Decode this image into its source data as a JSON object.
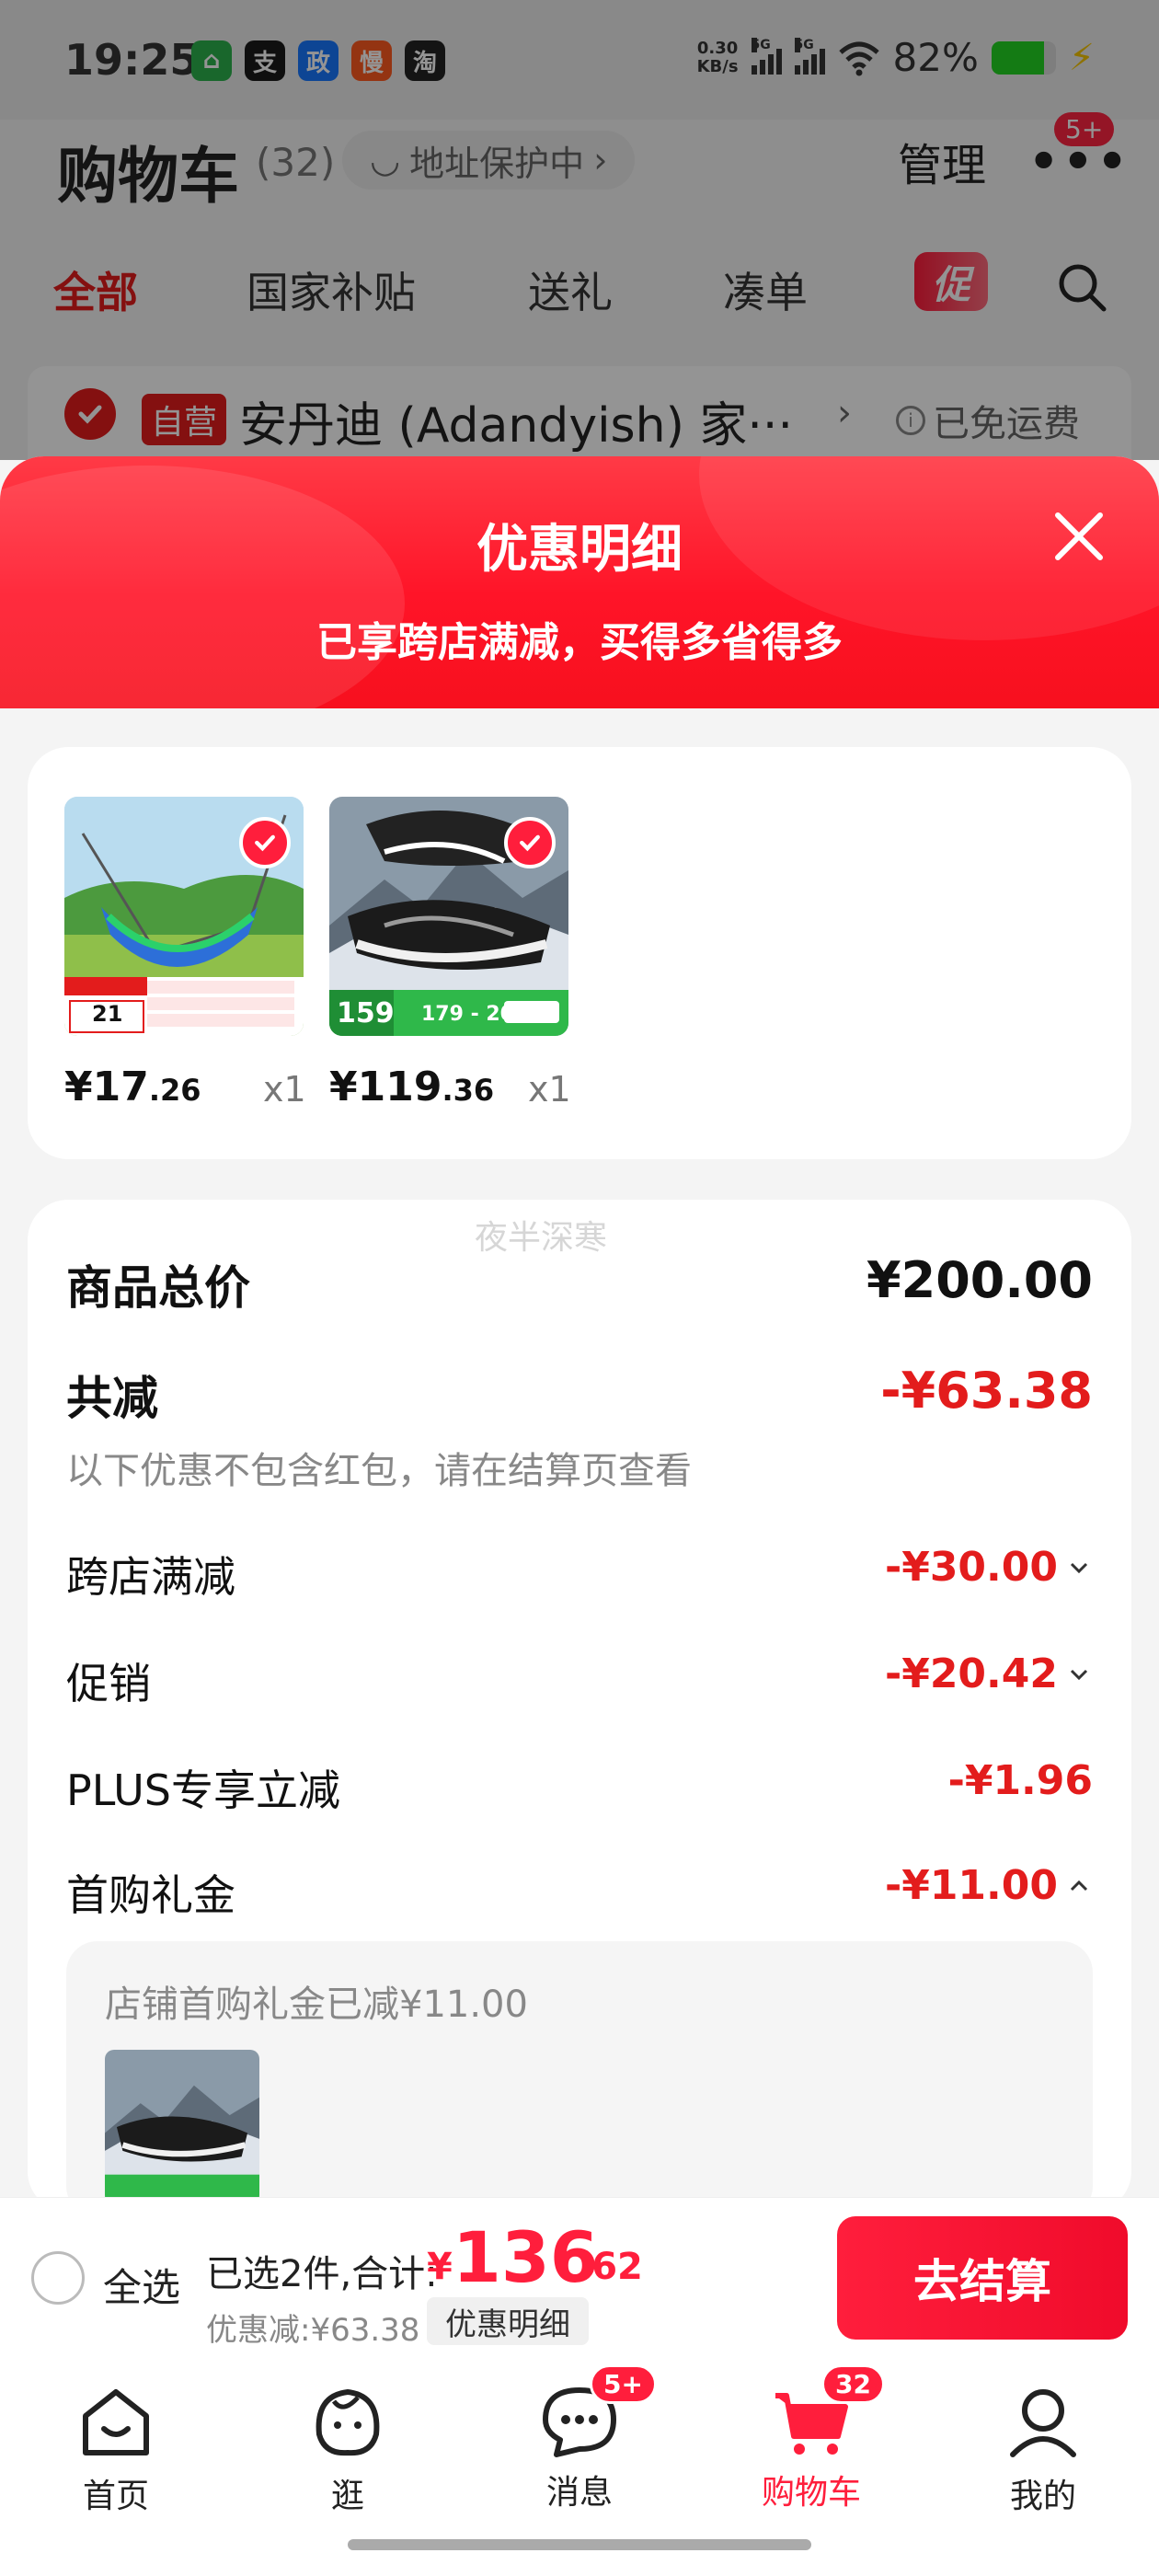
{
  "status_bar": {
    "time": "19:25",
    "apps": [
      {
        "name": "qianniu-app-icon",
        "glyph": "⌂",
        "color": "#2bb24c"
      },
      {
        "name": "alipay-app-icon",
        "glyph": "支",
        "color": "#1a1a1a"
      },
      {
        "name": "dingtalk-app-icon",
        "glyph": "政",
        "color": "#1677ff"
      },
      {
        "name": "slow-app-icon",
        "glyph": "慢",
        "color": "#ff5a1f"
      },
      {
        "name": "taobao-app-icon",
        "glyph": "淘",
        "color": "#222222"
      }
    ],
    "net_speed_value": "0.30",
    "net_speed_unit": "KB/s",
    "signal1_label": "5G",
    "signal2_label": "5G",
    "battery_percent_text": "82%",
    "battery_level": 0.82
  },
  "header": {
    "title": "购物车",
    "count": "(32)",
    "address_protect": "地址保护中",
    "manage": "管理",
    "more_badge": "5+"
  },
  "tabs": {
    "all": "全部",
    "subsidy": "国家补贴",
    "gift": "送礼",
    "bundle": "凑单",
    "promo": "促"
  },
  "store": {
    "badge": "自营",
    "name": "安丹迪 (Adandyish) 家···",
    "shipping": "已免运费"
  },
  "sheet": {
    "title": "优惠明细",
    "subtitle": "已享跨店满减，买得多省得多"
  },
  "products": [
    {
      "price_int": "¥17",
      "price_dec": ".26",
      "qty": "x1",
      "img_label": "21"
    },
    {
      "price_int": "¥119",
      "price_dec": ".36",
      "qty": "x1",
      "img_label_a": "159",
      "img_label_b": "179 - 20"
    }
  ],
  "summary": {
    "watermark": "夜半深寒",
    "total_label": "商品总价",
    "total_value": "¥200.00",
    "reduce_label": "共减",
    "reduce_value": "-¥63.38",
    "note": "以下优惠不包含红包，请在结算页查看",
    "items": [
      {
        "label": "跨店满减",
        "value": "-¥30.00",
        "expand": "down"
      },
      {
        "label": "促销",
        "value": "-¥20.42",
        "expand": "down"
      },
      {
        "label": "PLUS专享立减",
        "value": "-¥1.96",
        "expand": "none"
      },
      {
        "label": "首购礼金",
        "value": "-¥11.00",
        "expand": "up"
      }
    ],
    "gift_detail": "店铺首购礼金已减¥11.00"
  },
  "checkout": {
    "select_all": "全选",
    "selected_text": "已选2件,合计:",
    "total_currency": "¥",
    "total_int": "136",
    "total_dec": ".62",
    "discount_text": "优惠减:¥63.38",
    "detail_button": "优惠明细",
    "checkout_button": "去结算"
  },
  "tabbar": {
    "items": [
      {
        "label": "首页",
        "badge": ""
      },
      {
        "label": "逛",
        "badge": ""
      },
      {
        "label": "消息",
        "badge": "5+"
      },
      {
        "label": "购物车",
        "badge": "32"
      },
      {
        "label": "我的",
        "badge": ""
      }
    ]
  }
}
